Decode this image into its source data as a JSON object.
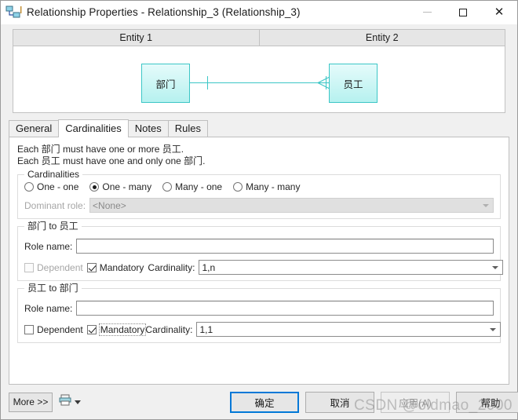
{
  "window": {
    "title": "Relationship Properties - Relationship_3 (Relationship_3)",
    "icon": "relationship-icon",
    "controls": {
      "minimize": "minimize-icon",
      "maximize": "maximize-icon",
      "close": "close-icon"
    }
  },
  "entity_header": {
    "entity1": "Entity 1",
    "entity2": "Entity 2"
  },
  "diagram": {
    "left_entity": "部门",
    "right_entity": "员工",
    "left_cardinality_symbol": "one",
    "right_cardinality_symbol": "many-crowsfoot",
    "box_fill": "#b6f1ef",
    "box_border": "#3cc6c6"
  },
  "tabs": [
    {
      "label": "General",
      "active": false
    },
    {
      "label": "Cardinalities",
      "active": true
    },
    {
      "label": "Notes",
      "active": false
    },
    {
      "label": "Rules",
      "active": false
    }
  ],
  "description": {
    "line1": "Each 部门 must have one or more 员工.",
    "line2": "Each 员工 must have one and only one 部门."
  },
  "cardinalities_group": {
    "legend": "Cardinalities",
    "options": [
      {
        "label": "One - one",
        "selected": false
      },
      {
        "label": "One - many",
        "selected": true
      },
      {
        "label": "Many - one",
        "selected": false
      },
      {
        "label": "Many - many",
        "selected": false
      }
    ],
    "dominant_role": {
      "label": "Dominant role:",
      "accel": "D",
      "value": "<None>",
      "disabled": true
    }
  },
  "role_group_1": {
    "legend": "部门 to 员工",
    "role_name_label": "Role name:",
    "role_name_accel": "R",
    "role_name_value": "",
    "dependent": {
      "label": "Dependent",
      "checked": false,
      "disabled": true,
      "accel": "e"
    },
    "mandatory": {
      "label": "Mandatory",
      "checked": true,
      "disabled": false,
      "accel": "M"
    },
    "cardinality": {
      "label": "Cardinality:",
      "accel": "C",
      "value": "1,n"
    }
  },
  "role_group_2": {
    "legend": "员工 to 部门",
    "role_name_label": "Role name:",
    "role_name_accel": "R",
    "role_name_value": "",
    "dependent": {
      "label": "Dependent",
      "checked": false,
      "disabled": false,
      "accel": "e"
    },
    "mandatory": {
      "label": "Mandatory",
      "checked": true,
      "disabled": false,
      "accel": "M",
      "focused": true
    },
    "cardinality": {
      "label": "Cardinality:",
      "accel": "i",
      "value": "1,1"
    }
  },
  "footer": {
    "more_label": "More >>",
    "printer_icon": "printer-icon",
    "printer_dropdown_icon": "chevron-down-icon",
    "ok_label": "确定",
    "cancel_label": "取消",
    "apply_label": "应用(A)",
    "help_label": "帮助",
    "apply_disabled": true
  },
  "watermark": "CSDN @oldmao_2000",
  "colors": {
    "accent": "#0078d7",
    "entity_cyan": "#3cc6c6",
    "dialog_bg": "#f0f0f0"
  }
}
